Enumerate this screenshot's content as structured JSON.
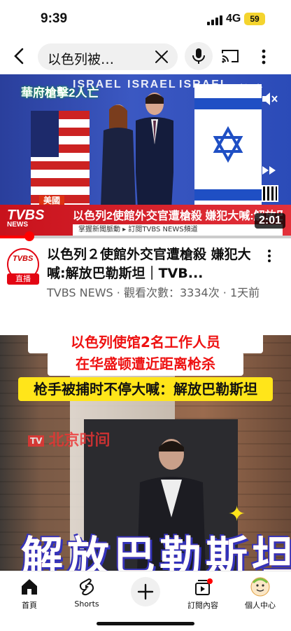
{
  "status_bar": {
    "time": "9:39",
    "network": "4G",
    "battery": "59"
  },
  "search": {
    "query": "以色列被…"
  },
  "video": {
    "overlay_title_top": "華府槍擊2人亡",
    "overlay_logo": "TVBS新聞台",
    "israel_wordmark": "ISRAEL",
    "location_tag": "美國",
    "overlay_logo_big": "TVBS",
    "overlay_logo_big_sub": "NEWS",
    "overlay_headline": "以色列2使館外交官遭槍殺 嫌犯大喊:解放巴勒斯坦",
    "overlay_subline": "掌握新聞脈動 ▸ 訂閱TVBS NEWS頻道",
    "duration": "2:01",
    "progress_fraction": 0.1,
    "title": "以色列２使館外交官遭槍殺 嫌犯大喊:解放巴勒斯坦｜TVB...",
    "channel": "TVBS NEWS",
    "views": "觀看次數：3334次",
    "age": "1天前",
    "channel_avatar_text": "TVBS",
    "live_label": "直播"
  },
  "short": {
    "caption_line1": "以色列使馆2名工作人员",
    "caption_line2": "在华盛顿遭近距离枪杀",
    "caption_line3": "枪手被捕时不停大喊：解放巴勒斯坦",
    "watermark": "北京时间",
    "watermark_badge": "TV",
    "big_caption": "解放巴勒斯坦"
  },
  "nav": {
    "home": "首頁",
    "shorts": "Shorts",
    "subscriptions": "訂閱內容",
    "you": "個人中心"
  },
  "colors": {
    "accent": "#ff0000",
    "brand_red": "#e30613"
  }
}
